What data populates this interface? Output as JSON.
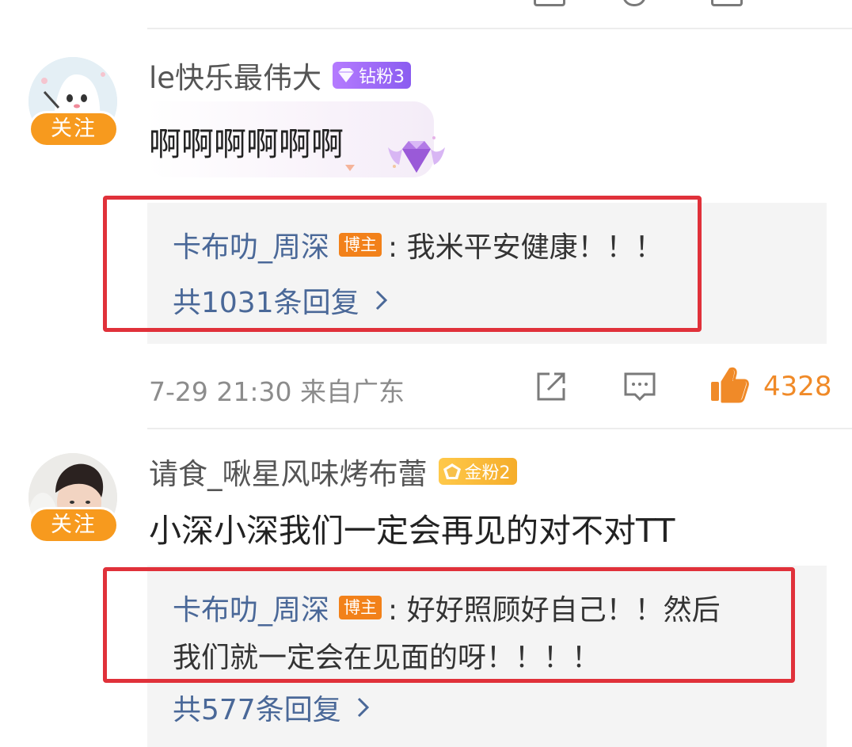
{
  "comments": [
    {
      "username": "le快乐最伟大",
      "fan_badge": "钻粉3",
      "follow_label": "关注",
      "text": "啊啊啊啊啊啊",
      "reply": {
        "author": "卡布叻_周深",
        "author_badge": "博主",
        "text": ": 我米平安健康！！！",
        "count_label": "共1031条回复"
      },
      "time_location": "7-29 21:30  来自广东",
      "likes": "4328"
    },
    {
      "username": "请食_啾星风味烤布蕾",
      "fan_badge": "金粉2",
      "follow_label": "关注",
      "text": "小深小深我们一定会再见的对不对TT",
      "reply": {
        "author": "卡布叻_周深",
        "author_badge": "博主",
        "text_line1": ": 好好照顾好自己！！然后",
        "text_line2": "我们就一定会在见面的呀！！！！",
        "count_label": "共577条回复"
      }
    }
  ],
  "colors": {
    "follow_orange": "#f79a1e",
    "reply_author_blue": "#4a6898",
    "highlight_red": "#e0313a",
    "like_orange": "#f08a28",
    "blogger_badge": "#f2811a"
  },
  "icons": [
    "share-icon",
    "comment-icon",
    "thumbs-up-icon",
    "chevron-right-icon",
    "diamond-gem-icon"
  ]
}
